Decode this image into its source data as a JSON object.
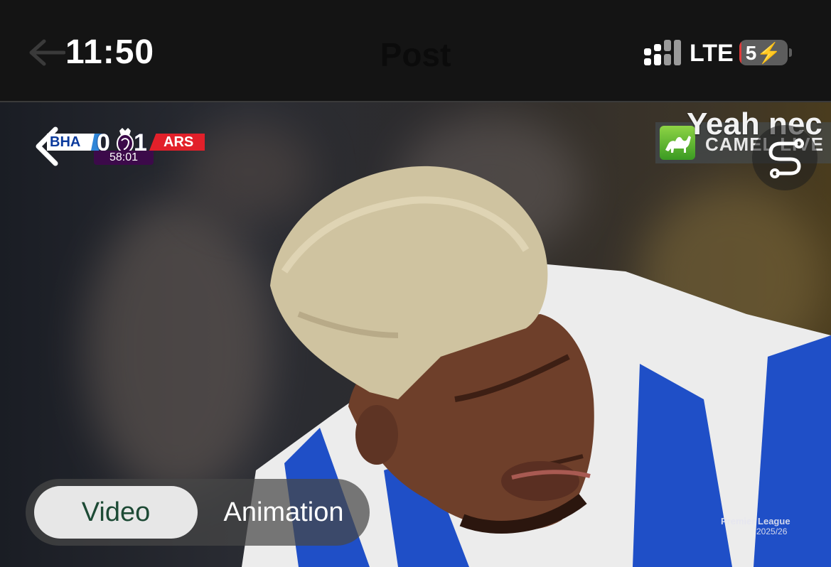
{
  "status_bar": {
    "time": "11:50",
    "title": "Post",
    "network": "LTE",
    "battery_level": "5",
    "back_icon": "back-arrow-icon",
    "signal_icon": "signal-dots-icon",
    "charging_icon": "lightning-icon"
  },
  "scorebug": {
    "home_team": "BHA",
    "home_score": "0",
    "away_score": "1",
    "away_team": "ARS",
    "clock": "58:01",
    "home_color": "#0b3a9c",
    "away_color": "#e2202a"
  },
  "overlays": {
    "comment_text": "Yeah nec",
    "sponsor_text": "CAMEL LIVE",
    "sponsor_icon": "camel-icon",
    "action_icon": "s-route-icon",
    "watermark_title": "Premier League",
    "watermark_season": "2025/26"
  },
  "segmented_control": {
    "options": [
      "Video",
      "Animation"
    ],
    "selected": "Video"
  }
}
